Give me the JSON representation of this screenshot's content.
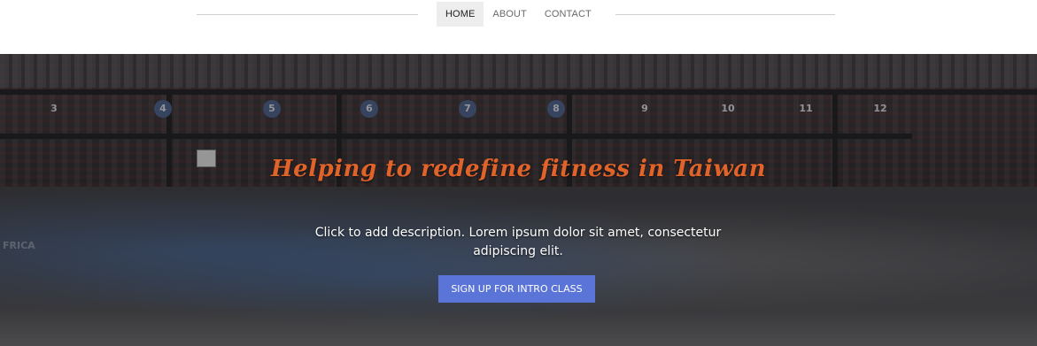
{
  "nav": {
    "items": [
      {
        "label": "HOME",
        "active": true
      },
      {
        "label": "ABOUT",
        "active": false
      },
      {
        "label": "CONTACT",
        "active": false
      }
    ]
  },
  "hero": {
    "headline": "Helping to redefine fitness in Taiwan",
    "description": "Click to add description. Lorem ipsum dolor sit amet, consectetur adipiscing elit.",
    "cta_label": "SIGN UP FOR INTRO CLASS",
    "background_text": "FRICA",
    "lane_numbers": [
      "3",
      "4",
      "5",
      "6",
      "7",
      "8",
      "9",
      "10",
      "11",
      "12"
    ]
  },
  "colors": {
    "headline": "#e0632a",
    "cta_background": "#5b74d8",
    "nav_active_background": "#ededed"
  }
}
